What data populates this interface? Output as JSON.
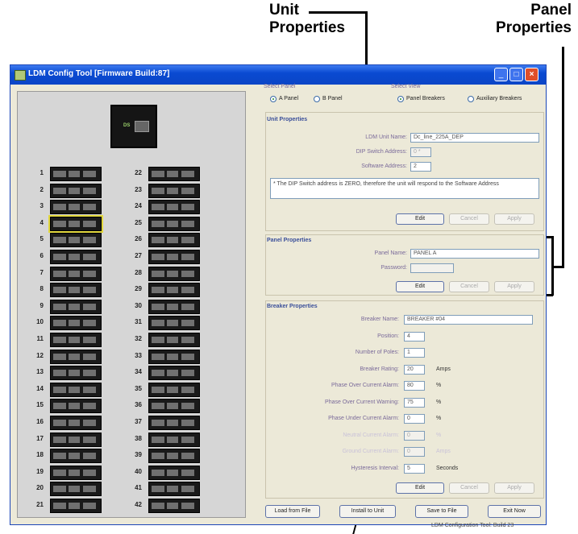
{
  "callouts": {
    "unit_line1": "Unit",
    "unit_line2": "Properties",
    "panel_line1": "Panel",
    "panel_line2": "Properties"
  },
  "window": {
    "title": "LDM Config Tool [Firmware Build:87]",
    "min": "_",
    "max": "□",
    "close": "×"
  },
  "unit_device_label": "DS",
  "breakers_left": [
    "1",
    "2",
    "3",
    "4",
    "5",
    "6",
    "7",
    "8",
    "9",
    "10",
    "11",
    "12",
    "13",
    "14",
    "15",
    "16",
    "17",
    "18",
    "19",
    "20",
    "21"
  ],
  "breakers_right": [
    "22",
    "23",
    "24",
    "25",
    "26",
    "27",
    "28",
    "29",
    "30",
    "31",
    "32",
    "33",
    "34",
    "35",
    "36",
    "37",
    "38",
    "39",
    "40",
    "41",
    "42"
  ],
  "select_panel": {
    "title": "Select Panel",
    "a": "A Panel",
    "b": "B Panel"
  },
  "select_view": {
    "title": "Select View",
    "breakers": "Panel Breakers",
    "auxiliary": "Auxiliary Breakers"
  },
  "unit_properties": {
    "title": "Unit Properties",
    "name_label": "LDM Unit Name:",
    "name_value": "Dc_line_225A_DEP",
    "dip_label": "DIP Switch Address:",
    "dip_value": "0 *",
    "sw_label": "Software Address:",
    "sw_value": "2",
    "note": "* The DIP Switch address is ZERO, therefore the unit will respond to the Software Address",
    "edit": "Edit",
    "cancel": "Cancel",
    "apply": "Apply"
  },
  "panel_properties": {
    "title": "Panel Properties",
    "name_label": "Panel Name:",
    "name_value": "PANEL A",
    "pw_label": "Password:",
    "pw_value": "",
    "edit": "Edit",
    "cancel": "Cancel",
    "apply": "Apply"
  },
  "breaker_properties": {
    "title": "Breaker Properties",
    "rows": [
      {
        "label": "Breaker Name:",
        "value": "BREAKER #04",
        "unit": ""
      },
      {
        "label": "Position:",
        "value": "4",
        "unit": ""
      },
      {
        "label": "Number of Poles:",
        "value": "1",
        "unit": ""
      },
      {
        "label": "Breaker Rating:",
        "value": "20",
        "unit": "Amps"
      },
      {
        "label": "Phase Over Current Alarm:",
        "value": "80",
        "unit": "%"
      },
      {
        "label": "Phase Over Current Warning:",
        "value": "75",
        "unit": "%"
      },
      {
        "label": "Phase Under Current Alarm:",
        "value": "0",
        "unit": "%"
      },
      {
        "label": "Neutral Current Alarm:",
        "value": "0",
        "unit": "%"
      },
      {
        "label": "Ground Current Alarm:",
        "value": "0",
        "unit": "Amps"
      },
      {
        "label": "Hysteresis Interval:",
        "value": "5",
        "unit": "Seconds"
      }
    ],
    "edit": "Edit",
    "cancel": "Cancel",
    "apply": "Apply"
  },
  "bottom_buttons": {
    "load": "Load from File",
    "install": "Install to Unit",
    "save": "Save to File",
    "exit": "Exit Now"
  },
  "status_text": "LDM Configuration Tool: Build 23",
  "colors": {
    "title_bar": "#0a4ad2",
    "window_bg": "#ece9d8",
    "selected_breaker": "#e2d83e",
    "section_title": "#3a4f9a"
  }
}
